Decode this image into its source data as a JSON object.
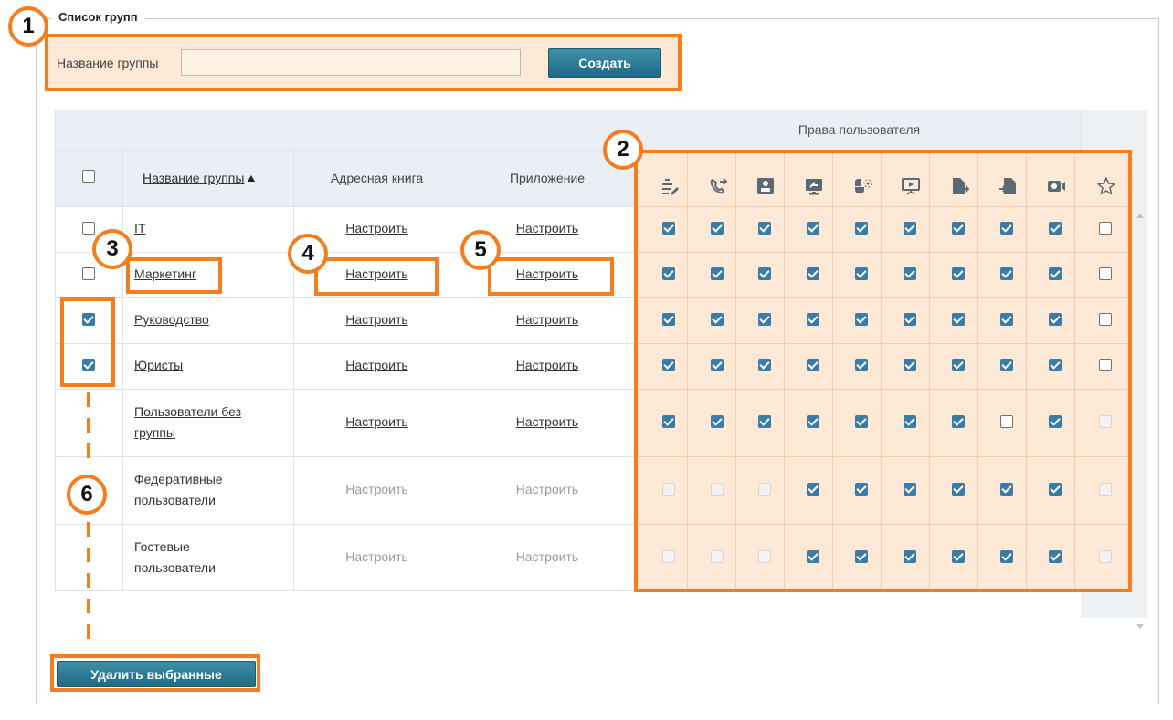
{
  "legend": "Список групп",
  "create_form": {
    "label": "Название группы",
    "input_value": "",
    "button": "Создать"
  },
  "table": {
    "rights_header": "Права пользователя",
    "col_name": "Название группы",
    "col_address_book": "Адресная книга",
    "col_application": "Приложение",
    "configure": "Настроить",
    "permission_icons": [
      "edit-icon",
      "call-transfer-icon",
      "group-icon",
      "screen-share-icon",
      "remote-control-icon",
      "presentation-icon",
      "file-send-icon",
      "file-receive-icon",
      "video-icon",
      "star-icon"
    ],
    "rows": [
      {
        "name": "IT",
        "row_check": "off",
        "name_link": true,
        "settings_active": true,
        "perms": [
          "on",
          "on",
          "on",
          "on",
          "on",
          "on",
          "on",
          "on",
          "on",
          "off"
        ]
      },
      {
        "name": "Маркетинг",
        "row_check": "off",
        "name_link": true,
        "settings_active": true,
        "perms": [
          "on",
          "on",
          "on",
          "on",
          "on",
          "on",
          "on",
          "on",
          "on",
          "off"
        ]
      },
      {
        "name": "Руководство",
        "row_check": "on",
        "name_link": true,
        "settings_active": true,
        "perms": [
          "on",
          "on",
          "on",
          "on",
          "on",
          "on",
          "on",
          "on",
          "on",
          "off"
        ]
      },
      {
        "name": "Юристы",
        "row_check": "on",
        "name_link": true,
        "settings_active": true,
        "perms": [
          "on",
          "on",
          "on",
          "on",
          "on",
          "on",
          "on",
          "on",
          "on",
          "off"
        ]
      },
      {
        "name_line1": "Пользователи без",
        "name_line2": "группы",
        "row_check": "none",
        "name_link": true,
        "settings_active": true,
        "perms": [
          "on",
          "on",
          "on",
          "on",
          "on",
          "on",
          "on",
          "off",
          "on",
          "dis"
        ]
      },
      {
        "name_line1": "Федеративные",
        "name_line2": "пользователи",
        "row_check": "none",
        "name_link": false,
        "settings_active": false,
        "perms": [
          "dis",
          "dis",
          "dis",
          "on",
          "on",
          "on",
          "on",
          "on",
          "on",
          "dis"
        ]
      },
      {
        "name_line1": "Гостевые",
        "name_line2": "пользователи",
        "row_check": "none",
        "name_link": false,
        "settings_active": false,
        "perms": [
          "dis",
          "dis",
          "dis",
          "on",
          "on",
          "on",
          "on",
          "on",
          "on",
          "dis"
        ]
      }
    ]
  },
  "delete_button": "Удалить выбранные",
  "callouts": [
    "1",
    "2",
    "3",
    "4",
    "5",
    "6"
  ],
  "colors": {
    "accent": "#f57c1f",
    "button": "#2a7792",
    "checkbox": "#3a7ca5",
    "panel": "#fde9d6"
  }
}
